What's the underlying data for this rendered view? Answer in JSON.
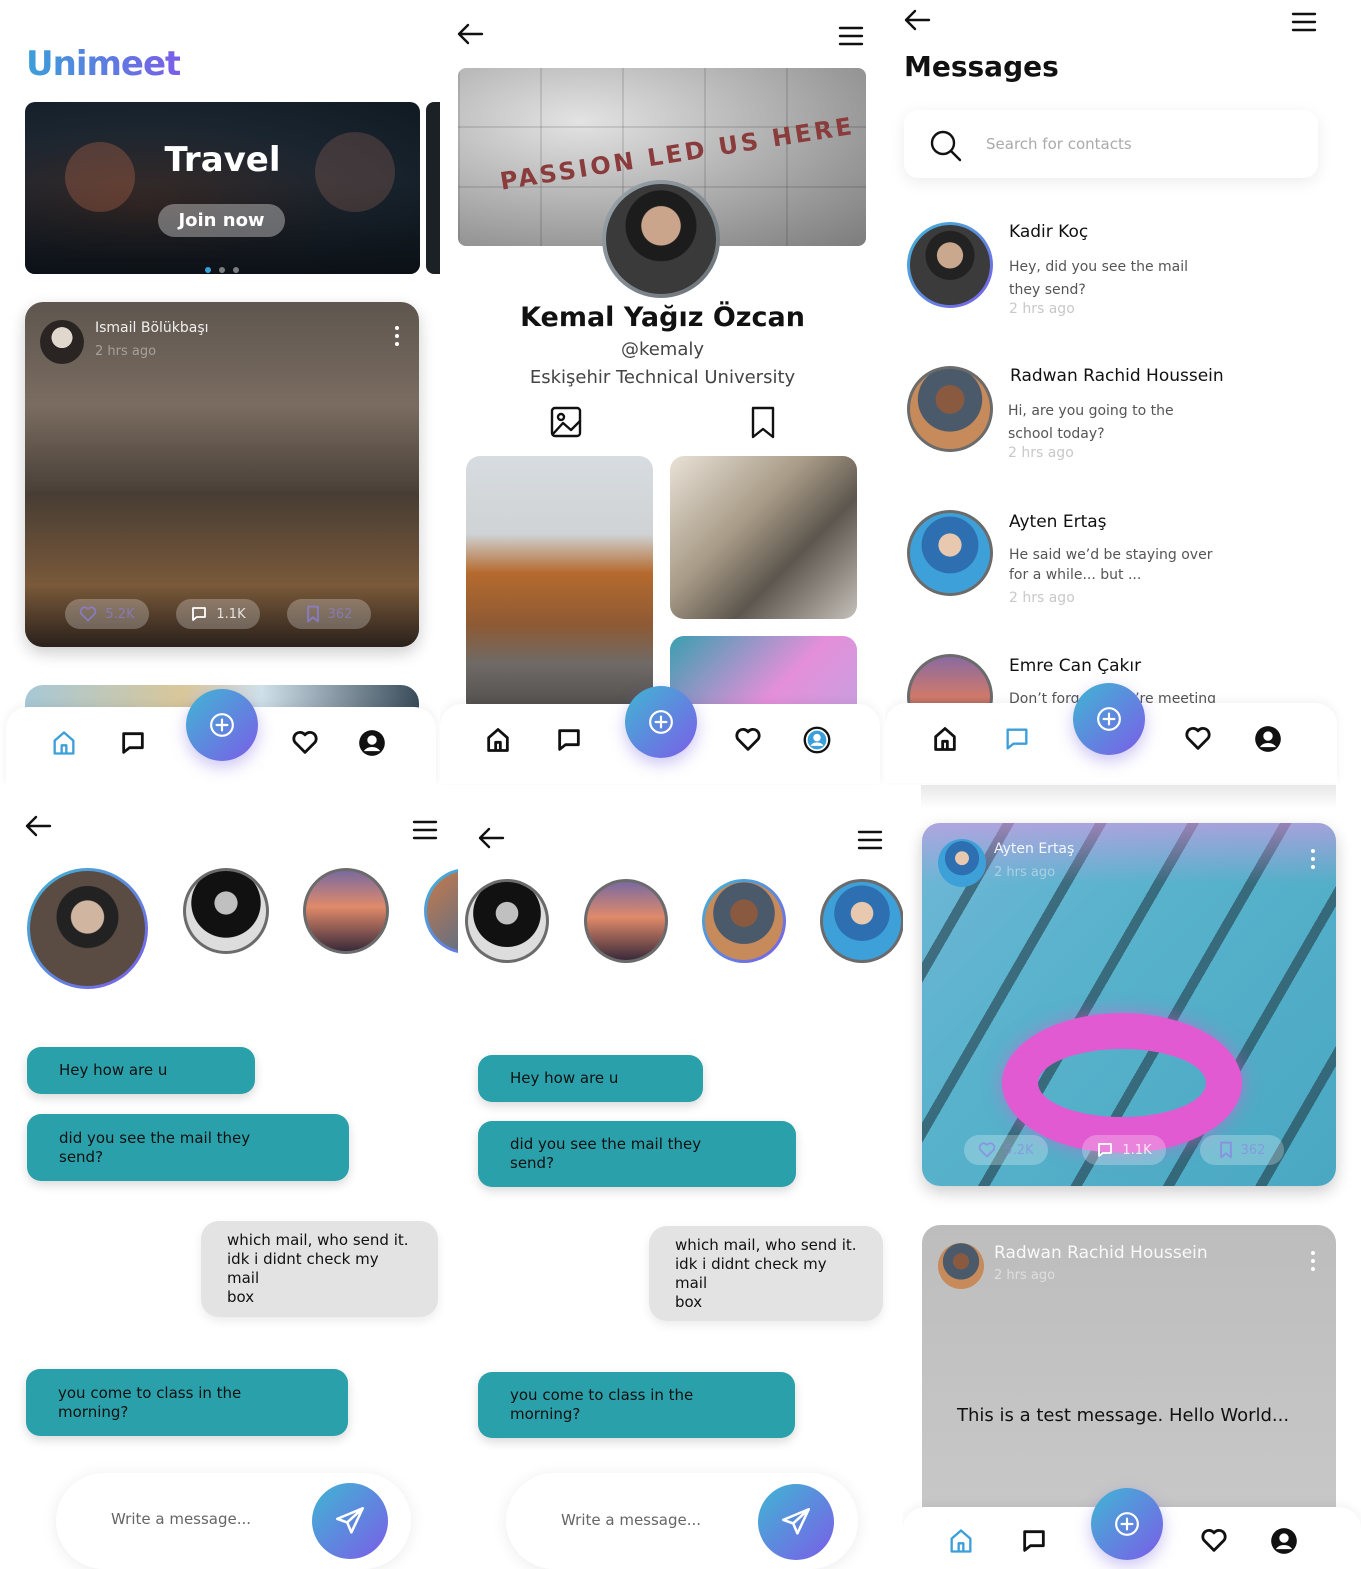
{
  "home": {
    "logo": "Unimeet",
    "banner": {
      "title": "Travel",
      "button": "Join now"
    },
    "post": {
      "author": "Ismail Bölükbaşı",
      "time": "2 hrs ago",
      "likes": "5.2K",
      "comments": "1.1K",
      "saves": "362"
    }
  },
  "profile": {
    "cover_text": "PASSION LED US HERE",
    "name": "Kemal Yağız Özcan",
    "handle": "@kemaly",
    "university": "Eskişehir Technical University"
  },
  "messages": {
    "title": "Messages",
    "search_placeholder": "Search for contacts",
    "contacts": [
      {
        "name": "Kadir Koç",
        "preview_l1": "Hey, did you see the mail",
        "preview_l2": "they send?",
        "time": "2 hrs ago"
      },
      {
        "name": "Radwan Rachid Houssein",
        "preview_l1": "Hi, are you going to the",
        "preview_l2": "school today?",
        "time": "2 hrs ago"
      },
      {
        "name": "Ayten Ertaş",
        "preview_l1": "He said we’d be staying over",
        "preview_l2": "for a while... but ...",
        "time": "2 hrs ago"
      },
      {
        "name": "Emre Can Çakır",
        "preview_l1": "Don’t forget there’re meeting",
        "preview_l2": "",
        "time": ""
      }
    ]
  },
  "chat": {
    "messages": [
      {
        "from": "me",
        "line1": "Hey how are u",
        "line2": ""
      },
      {
        "from": "me",
        "line1": "did you see the mail they",
        "line2": "send?"
      },
      {
        "from": "them",
        "line1": "which mail, who send it.",
        "line2": "idk i didnt check my mail",
        "line3": "box"
      },
      {
        "from": "me",
        "line1": "you come to class in the",
        "line2": "morning?"
      }
    ],
    "input_placeholder": "Write a message..."
  },
  "feed": {
    "post1": {
      "author": "Ayten Ertaş",
      "time": "2 hrs ago",
      "likes": "5.2K",
      "comments": "1.1K",
      "saves": "362"
    },
    "post2": {
      "author": "Radwan Rachid Houssein",
      "time": "2 hrs ago",
      "text": "This is a test message. Hello World..."
    }
  },
  "colors": {
    "accent_teal": "#2aa0aa",
    "gradient_start": "#3fb6d3",
    "gradient_end": "#7b5de8",
    "active_nav": "#3b9fd9"
  },
  "icons": [
    "home-icon",
    "chat-icon",
    "plus-circle-icon",
    "heart-icon",
    "user-icon",
    "back-arrow-icon",
    "menu-icon",
    "search-icon",
    "image-icon",
    "bookmark-icon",
    "send-icon",
    "comment-icon",
    "kebab-icon"
  ]
}
